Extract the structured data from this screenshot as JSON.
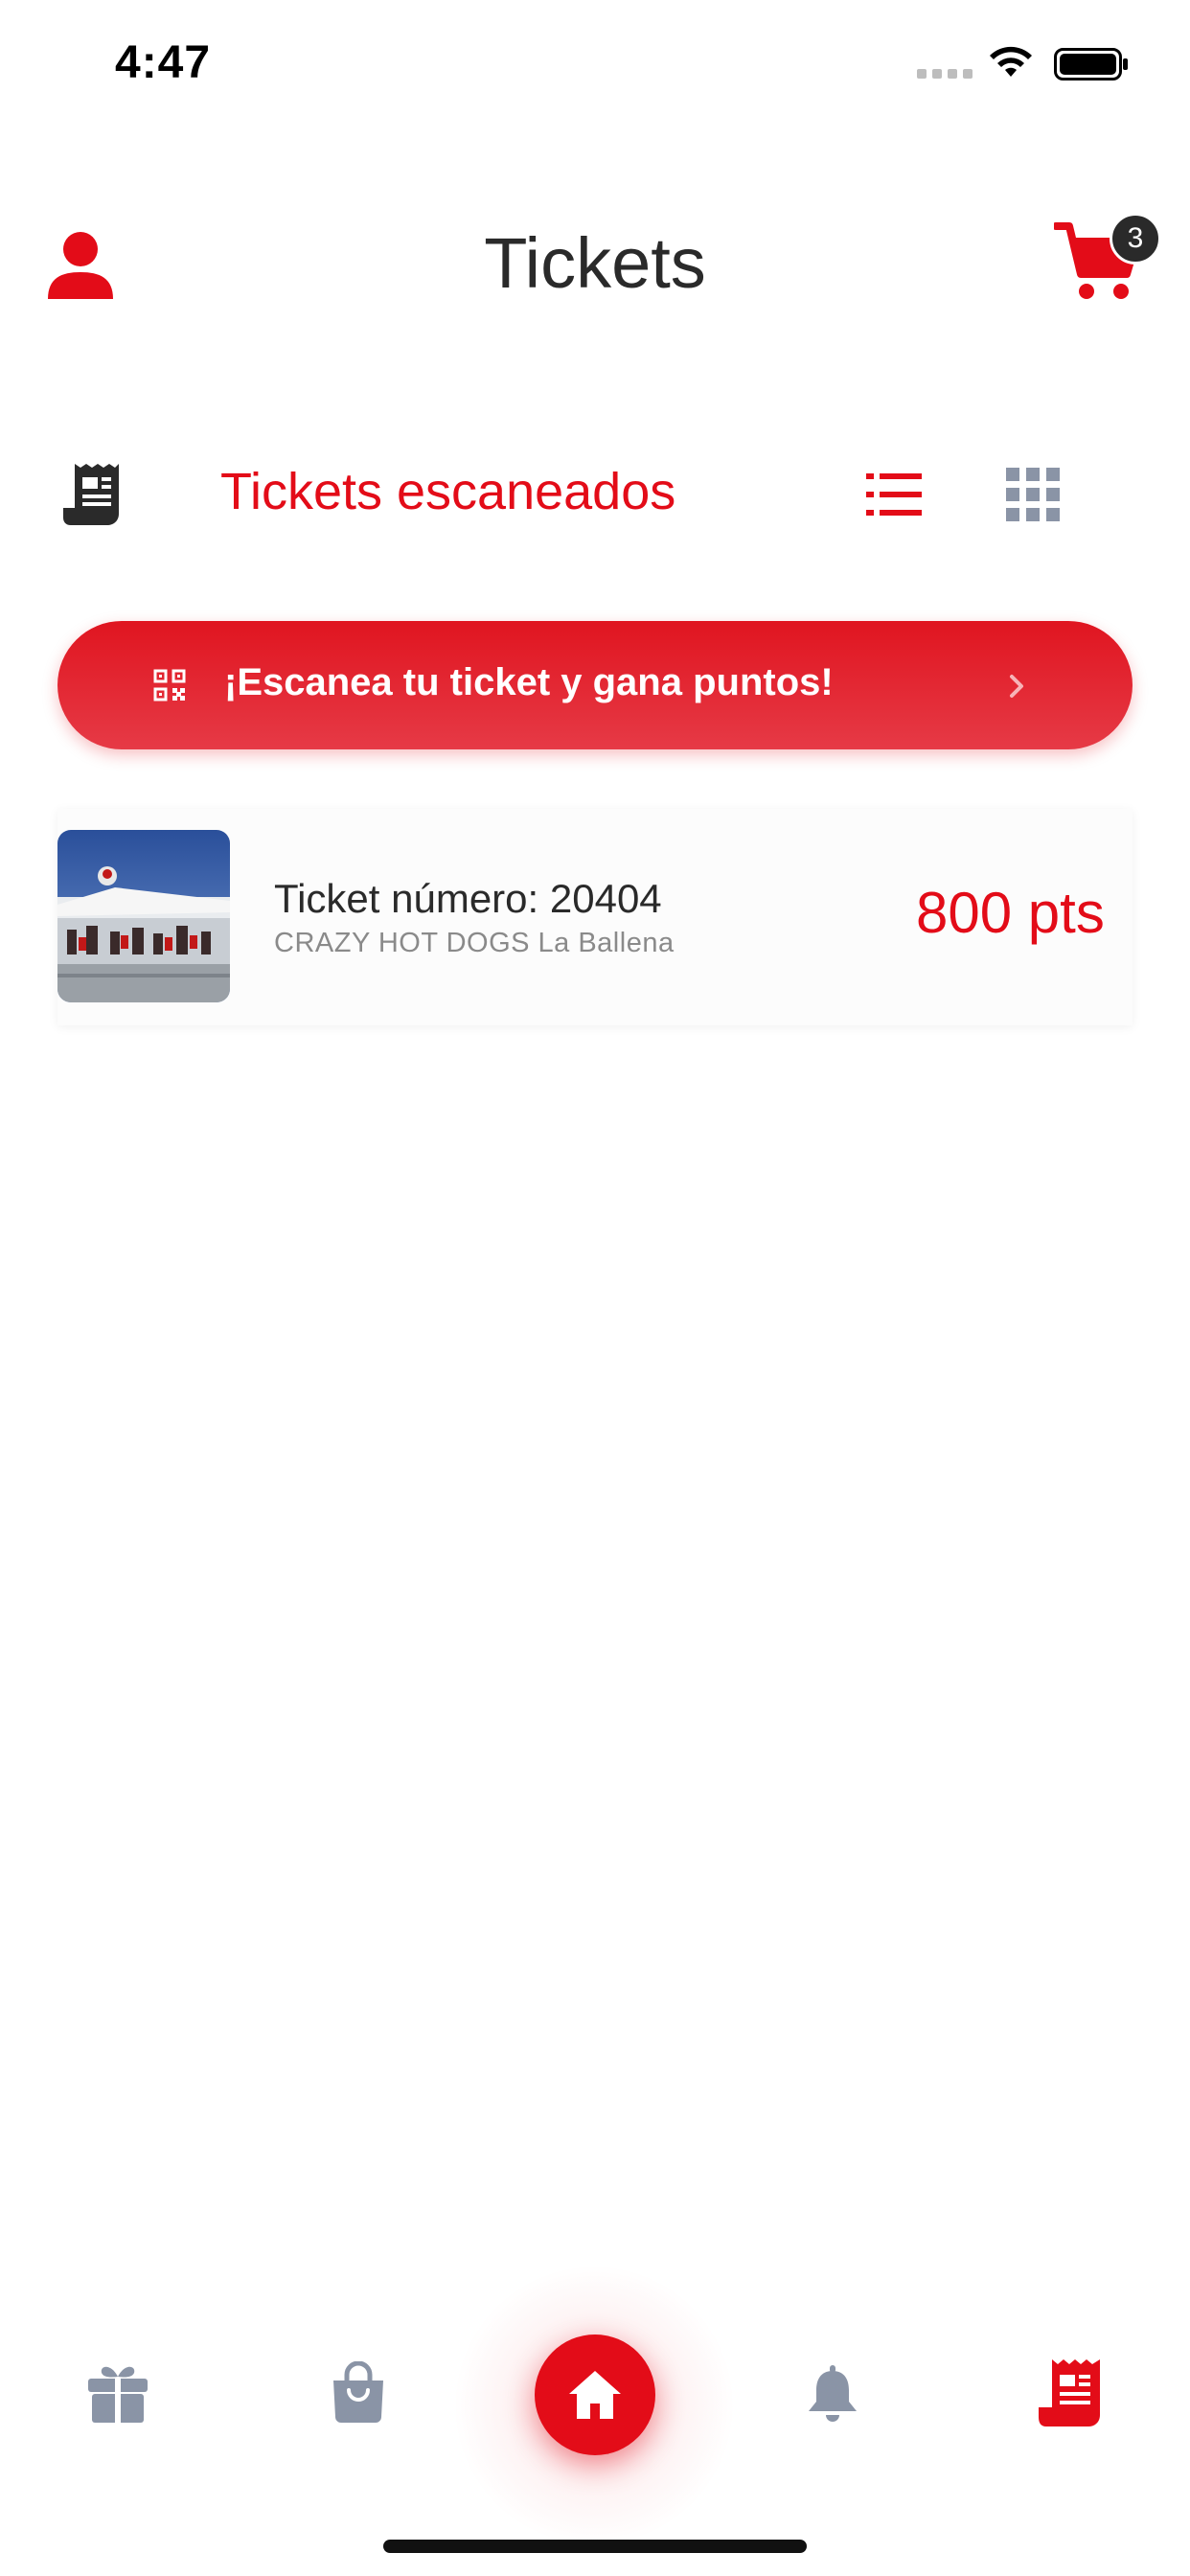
{
  "status_bar": {
    "time": "4:47"
  },
  "header": {
    "title": "Tickets",
    "cart_count": "3"
  },
  "section": {
    "title": "Tickets escaneados"
  },
  "scan_banner": {
    "label": "¡Escanea tu ticket y gana puntos!"
  },
  "tickets": [
    {
      "number": "Ticket número: 20404",
      "store": "CRAZY HOT DOGS La Ballena",
      "points": "800 pts"
    }
  ],
  "tab_bar": {
    "items": [
      {
        "name": "gift",
        "icon": "gift-icon",
        "active": false
      },
      {
        "name": "shop",
        "icon": "bag-icon",
        "active": false
      },
      {
        "name": "home",
        "icon": "home-icon",
        "active": false
      },
      {
        "name": "notifications",
        "icon": "bell-icon",
        "active": false
      },
      {
        "name": "tickets",
        "icon": "receipt-icon",
        "active": true
      }
    ]
  },
  "colors": {
    "accent": "#e30c18",
    "inactive_icon": "#8a94a6",
    "text_dark": "#2a2a2a"
  }
}
